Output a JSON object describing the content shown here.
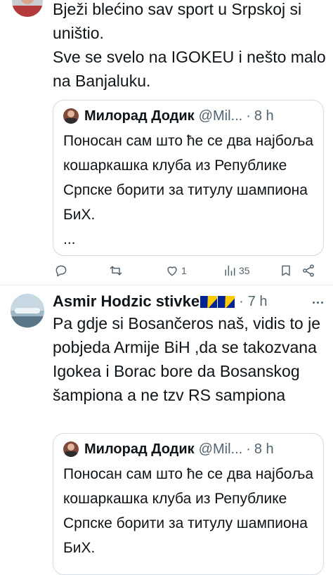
{
  "tweet1": {
    "lines": [
      "Bježi blećino sav sport u Srpskoj si uništio.",
      "Sve se svelo na IGOKEU i nešto malo na Banjaluku."
    ],
    "text": "Bježi blećino sav sport u Srpskoj si uništio.\nSve se svelo na IGOKEU i nešto malo na Banjaluku."
  },
  "quote1": {
    "name": "Милорад Додик",
    "handle": "@Mil...",
    "dot": "·",
    "time": "8 h",
    "body": "Поносан сам што ће се два најбоља кошаркашка клуба из Републике Српске борити за титулу шампиона БиХ.\n..."
  },
  "actions1": {
    "likes": "1",
    "views": "35",
    "icons": [
      "reply-icon",
      "retweet-icon",
      "like-icon",
      "views-icon",
      "bookmark-icon",
      "share-icon"
    ]
  },
  "tweet2": {
    "name": "Asmir Hodzic stivke",
    "dot": "·",
    "time": "7 h",
    "text": "Pa gdje si Bosančeros naš, vidis to je pobjeda Armije BiH ,da se takozvana Igokea i Borac bore da Bosanskog šampiona a ne tzv RS sampiona"
  },
  "quote2": {
    "name": "Милорад Додик",
    "handle": "@Mil...",
    "dot": "·",
    "time": "8 h",
    "body": "Поносан сам што ће се два најбоља кошаркашка клуба из Републике Српске борити за титулу шампиона БиХ."
  },
  "colors": {
    "text": "#0f1419",
    "secondary": "#536471",
    "border": "#d4dbe1",
    "flag_blue": "#002395",
    "flag_yellow": "#fecb00"
  }
}
